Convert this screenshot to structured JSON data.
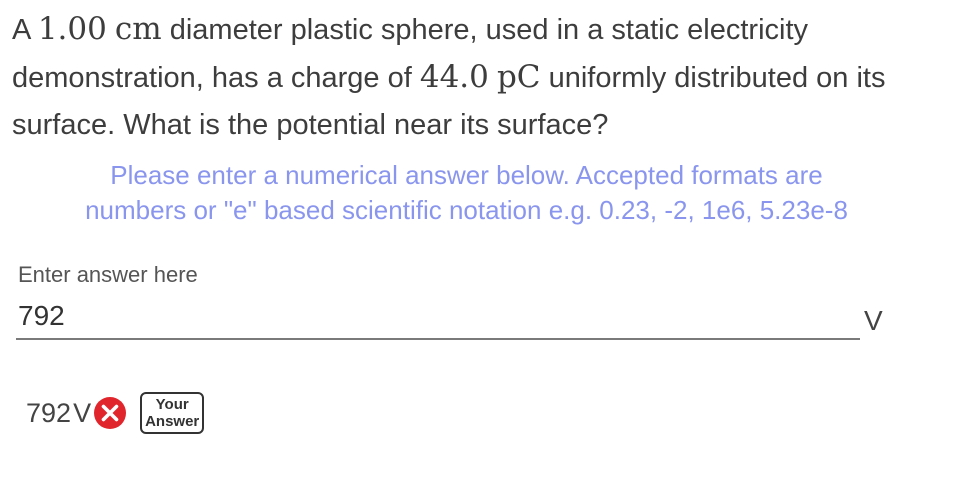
{
  "question": {
    "text_1": "A ",
    "diameter_value": "1.00",
    "diameter_unit": "cm",
    "text_2": " diameter plastic sphere, used in a static electricity demonstration, has a charge of ",
    "charge_value": "44.0",
    "charge_unit": "pC",
    "text_3": " uniformly distributed on its surface. What is the potential near its surface?"
  },
  "instructions": {
    "line_1": "Please enter a numerical answer below. Accepted formats are",
    "line_2": "numbers or \"e\" based scientific notation e.g. 0.23, -2, 1e6, 5.23e-8"
  },
  "answer_field": {
    "label": "Enter answer here",
    "value": "792",
    "unit": "V"
  },
  "result": {
    "value": "792",
    "unit": "V",
    "status": "incorrect",
    "status_color": "#e0262c",
    "badge_line_1": "Your",
    "badge_line_2": "Answer"
  },
  "colors": {
    "instruction_text": "#8a96ee",
    "error_red": "#e0262c"
  }
}
